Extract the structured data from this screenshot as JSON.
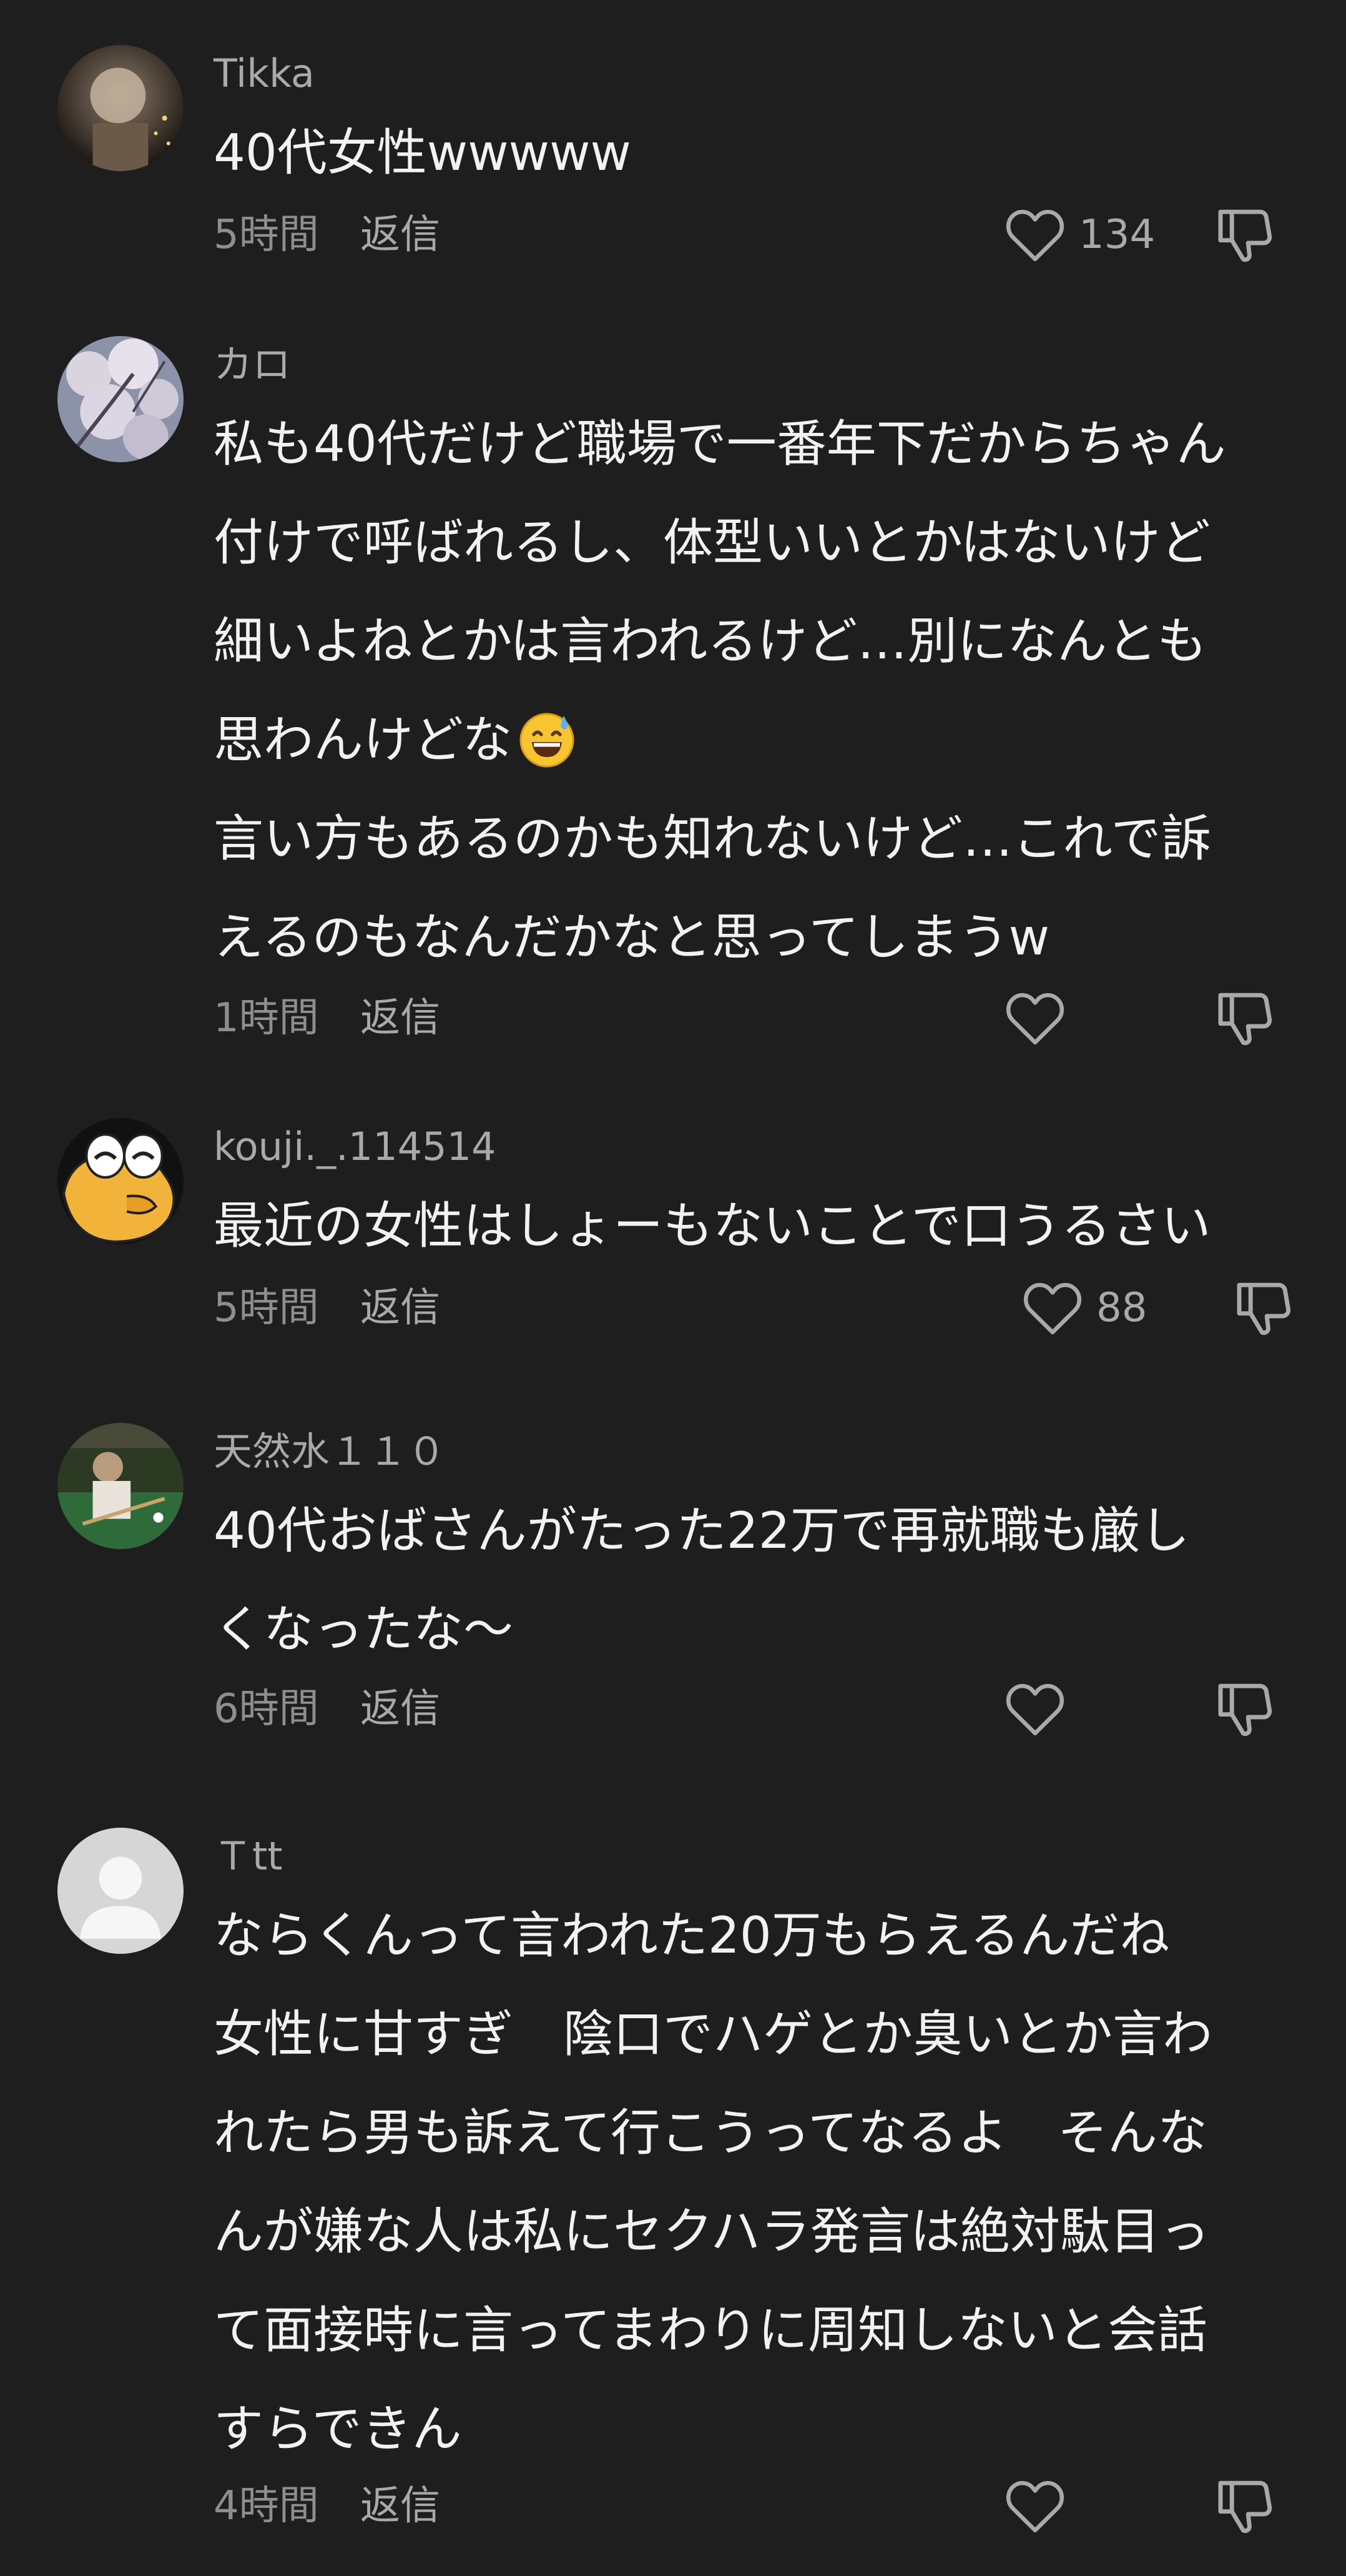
{
  "comments": [
    {
      "username": "Tikka",
      "lines": [
        "40代女性wwwww"
      ],
      "time": "5時間",
      "reply_label": "返信",
      "like_count": "134"
    },
    {
      "username": "カロ",
      "lines": [
        "私も40代だけど職場で一番年下だからちゃん",
        "付けで呼ばれるし、体型いいとかはないけど",
        "細いよねとかは言われるけど…別になんとも",
        "思わんけどな",
        "言い方もあるのかも知れないけど…これで訴",
        "えるのもなんだかなと思ってしまうw"
      ],
      "emoji": "grinning-sweat-emoji",
      "time": "1時間",
      "reply_label": "返信",
      "like_count": ""
    },
    {
      "username": "kouji._.114514",
      "lines": [
        "最近の女性はしょーもないことで口うるさい"
      ],
      "time": "5時間",
      "reply_label": "返信",
      "like_count": "88"
    },
    {
      "username": "天然水１１０",
      "lines": [
        "40代おばさんがたった22万で再就職も厳し",
        "くなったな〜"
      ],
      "time": "6時間",
      "reply_label": "返信",
      "like_count": ""
    },
    {
      "username": "Ｔtt",
      "lines": [
        "ならくんって言われた20万もらえるんだね",
        "女性に甘すぎ　陰口でハゲとか臭いとか言わ",
        "れたら男も訴えて行こうってなるよ　そんな",
        "んが嫌な人は私にセクハラ発言は絶対駄目っ",
        "て面接時に言ってまわりに周知しないと会話",
        "すらできん"
      ],
      "time": "4時間",
      "reply_label": "返信",
      "like_count": ""
    }
  ],
  "icons": {
    "like": "heart-outline-icon",
    "dislike": "thumbs-down-outline-icon"
  },
  "colors": {
    "background": "#1e1e1e",
    "text": "#f2f2f2",
    "secondary": "#a9a9a9",
    "meta": "#8e8e8e"
  }
}
